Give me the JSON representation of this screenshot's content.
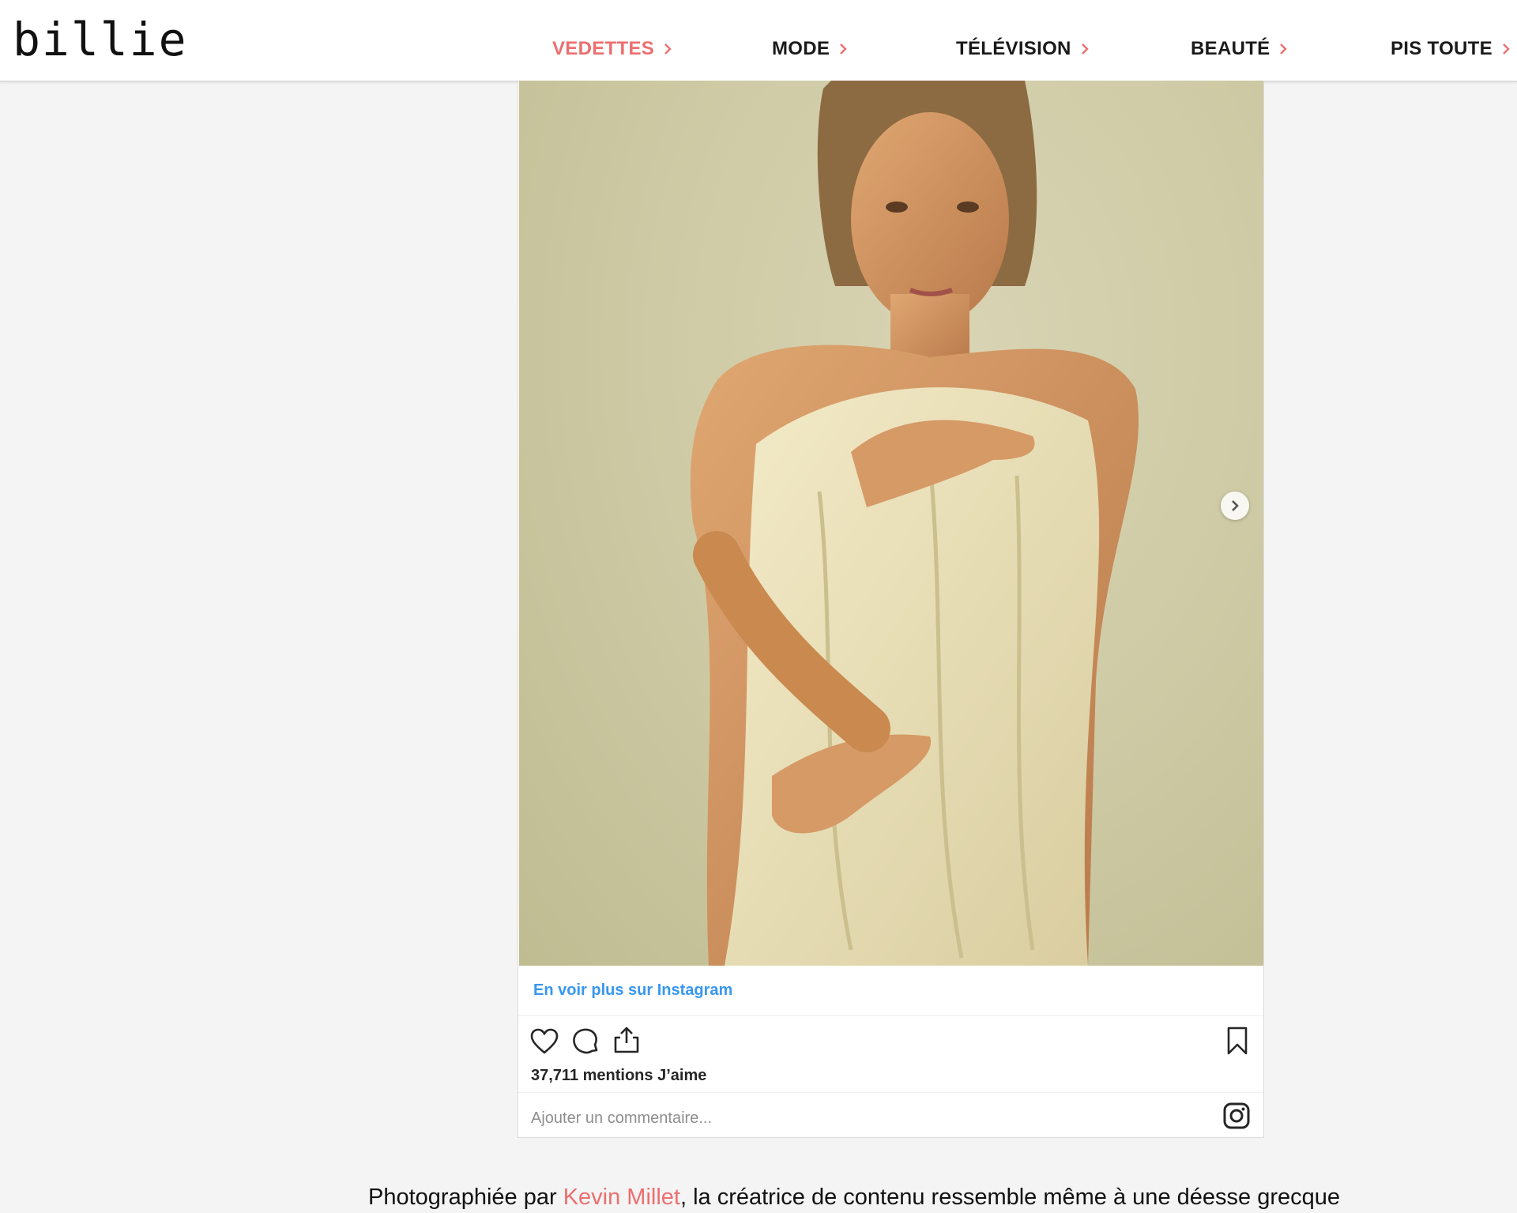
{
  "site": {
    "logo": "billie"
  },
  "nav": {
    "items": [
      {
        "label": "VEDETTES",
        "active": true
      },
      {
        "label": "MODE",
        "active": false
      },
      {
        "label": "TÉLÉVISION",
        "active": false
      },
      {
        "label": "BEAUTÉ",
        "active": false
      },
      {
        "label": "PIS TOUTE",
        "active": false
      }
    ],
    "accent_color": "#ec6f6f"
  },
  "instagram_embed": {
    "more_link": "En voir plus sur Instagram",
    "likes": "37,711 mentions J’aime",
    "comment_placeholder": "Ajouter un commentaire...",
    "icons": [
      "heart-icon",
      "comment-icon",
      "share-icon",
      "bookmark-icon",
      "instagram-icon",
      "chevron-right-icon"
    ],
    "link_color": "#3897f0"
  },
  "caption": {
    "before": "Photographiée par ",
    "link": "Kevin Millet",
    "after": ", la créatrice de contenu ressemble même à une déesse grecque"
  }
}
